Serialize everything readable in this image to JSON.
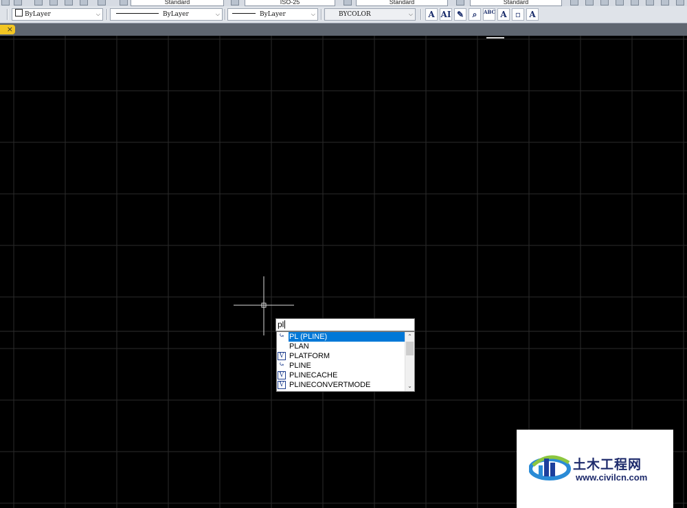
{
  "top_toolbar": {
    "text_style": "Standard",
    "dim_style": "ISO-25",
    "table_style": "Standard",
    "mleader_style": "Standard"
  },
  "properties_toolbar": {
    "color": "ByLayer",
    "linetype": "ByLayer",
    "lineweight": "ByLayer",
    "plotstyle": "BYCOLOR",
    "text_tools": [
      "A",
      "AI",
      "ABC"
    ]
  },
  "tab": {
    "close_glyph": "×"
  },
  "command_line": {
    "input_value": "pl",
    "suggestions": [
      {
        "label": "PL (PLINE)",
        "icon": "polyline-command-icon",
        "selected": true
      },
      {
        "label": "PLAN",
        "icon": "none",
        "selected": false
      },
      {
        "label": "PLATFORM",
        "icon": "system-variable-icon",
        "selected": false
      },
      {
        "label": "PLINE",
        "icon": "polyline-command-icon",
        "selected": false
      },
      {
        "label": "PLINECACHE",
        "icon": "system-variable-icon",
        "selected": false
      },
      {
        "label": "PLINECONVERTMODE",
        "icon": "system-variable-icon",
        "selected": false
      }
    ]
  },
  "watermark": {
    "site_name_cn": "土木工程网",
    "url": "www.civilcn.com"
  },
  "colors": {
    "canvas": "#000000",
    "grid": "#2b2b2b",
    "selection": "#0078d7",
    "tab_marker": "#f3c623"
  }
}
